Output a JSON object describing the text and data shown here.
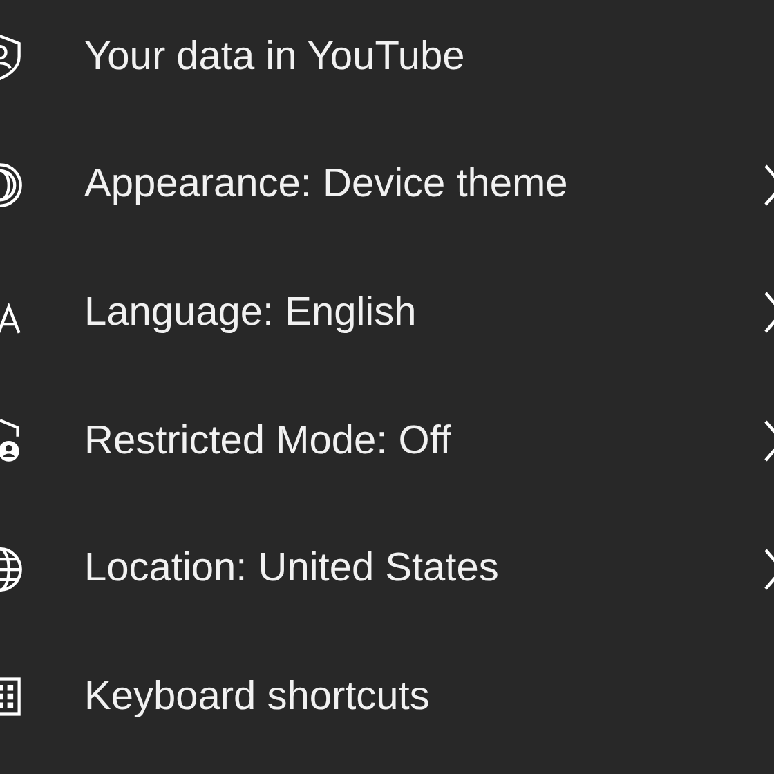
{
  "settings_items": [
    {
      "label": "Your data in YouTube",
      "has_chevron": false
    },
    {
      "label": "Appearance: Device theme",
      "has_chevron": true
    },
    {
      "label": "Language: English",
      "has_chevron": true
    },
    {
      "label": "Restricted Mode: Off",
      "has_chevron": true
    },
    {
      "label": "Location: United States",
      "has_chevron": true
    },
    {
      "label": "Keyboard shortcuts",
      "has_chevron": false
    }
  ]
}
